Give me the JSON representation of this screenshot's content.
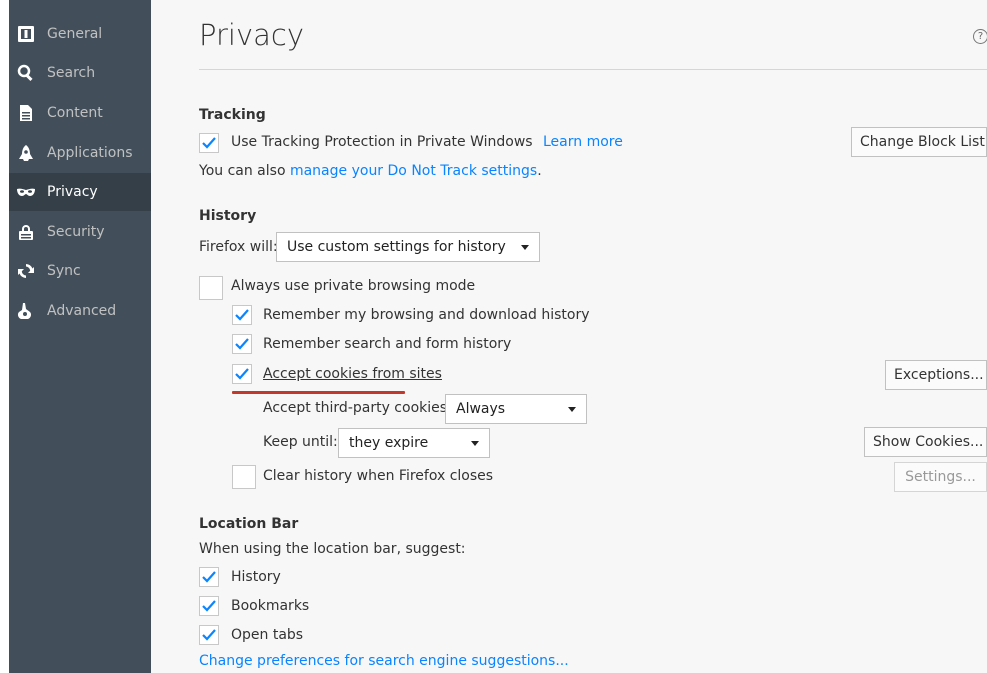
{
  "sidebar": {
    "items": [
      {
        "label": "General",
        "icon": "general-icon",
        "selected": false
      },
      {
        "label": "Search",
        "icon": "search-icon",
        "selected": false
      },
      {
        "label": "Content",
        "icon": "content-icon",
        "selected": false
      },
      {
        "label": "Applications",
        "icon": "applications-icon",
        "selected": false
      },
      {
        "label": "Privacy",
        "icon": "privacy-mask-icon",
        "selected": true
      },
      {
        "label": "Security",
        "icon": "security-icon",
        "selected": false
      },
      {
        "label": "Sync",
        "icon": "sync-icon",
        "selected": false
      },
      {
        "label": "Advanced",
        "icon": "advanced-icon",
        "selected": false
      }
    ]
  },
  "page": {
    "title": "Privacy",
    "help": "?"
  },
  "tracking": {
    "heading": "Tracking",
    "use_tp_label": "Use Tracking Protection in Private Windows",
    "use_tp_checked": true,
    "learn_more": "Learn more",
    "change_block_list": "Change Block List",
    "dnt_prefix": "You can also ",
    "dnt_link": "manage your Do Not Track settings",
    "dnt_suffix": "."
  },
  "history": {
    "heading": "History",
    "firefox_will_label": "Firefox will:",
    "firefox_will_value": "Use custom settings for history",
    "always_private_label": "Always use private browsing mode",
    "always_private_checked": false,
    "remember_browsing_label": "Remember my browsing and download history",
    "remember_browsing_checked": true,
    "remember_search_label": "Remember search and form history",
    "remember_search_checked": true,
    "accept_cookies_label": "Accept cookies from sites",
    "accept_cookies_checked": true,
    "exceptions_button": "Exceptions...",
    "third_party_label": "Accept third-party cookies:",
    "third_party_value": "Always",
    "keep_until_label": "Keep until:",
    "keep_until_value": "they expire",
    "show_cookies_button": "Show Cookies...",
    "clear_history_label": "Clear history when Firefox closes",
    "clear_history_checked": false,
    "settings_button": "Settings..."
  },
  "location_bar": {
    "heading": "Location Bar",
    "suggest_label": "When using the location bar, suggest:",
    "history_label": "History",
    "history_checked": true,
    "bookmarks_label": "Bookmarks",
    "bookmarks_checked": true,
    "open_tabs_label": "Open tabs",
    "open_tabs_checked": true,
    "change_prefs_link": "Change preferences for search engine suggestions..."
  },
  "colors": {
    "sidebar_bg": "#424f5a",
    "sidebar_selected": "#343f48",
    "link": "#0a84ff",
    "check": "#0a84ff",
    "highlight_underline": "#c0392b"
  }
}
